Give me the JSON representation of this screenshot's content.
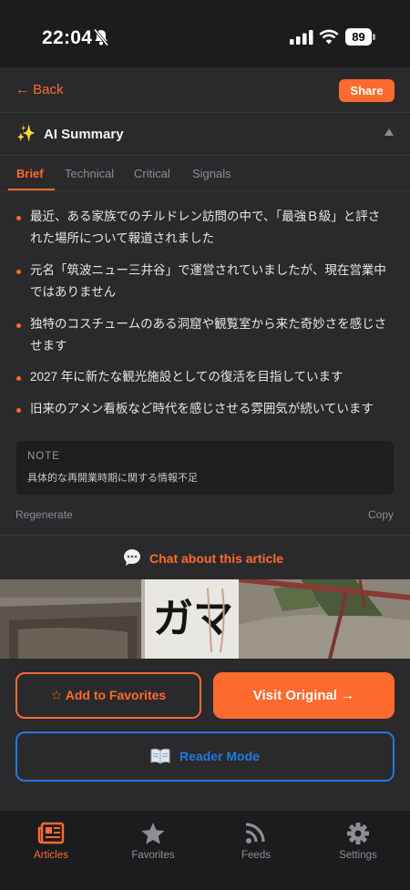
{
  "status_bar": {
    "time": "22:04",
    "battery": "89"
  },
  "nav": {
    "back_label": "← Back",
    "share_label": "Share"
  },
  "summary": {
    "icon": "sparkles-icon",
    "title": "AI Summary",
    "tabs": [
      "Brief",
      "Technical",
      "Critical",
      "Signals"
    ],
    "active_tab": "Brief",
    "bullets": [
      "最近、ある家族でのチルドレン訪問の中で、「最強Ｂ級」と評された場所について報道されました",
      "元名「筑波ニュー三井谷」で運営されていましたが、現在営業中ではありません",
      "独特のコスチュームのある洞窟や観覧室から来た奇妙さを感じさせます",
      "2027 年に新たな観光施設としての復活を目指しています",
      "旧来のアメン看板など時代を感じさせる雰囲気が続いています"
    ],
    "note_label": "NOTE",
    "note_text": "具体的な再開業時期に関する情報不足",
    "regenerate_label": "Regenerate",
    "copy_label": "Copy"
  },
  "chat": {
    "label": "Chat about this article"
  },
  "photo": {
    "sign_text": "ガマ"
  },
  "actions": {
    "favorites_label": "☆ Add to Favorites",
    "visit_label": "Visit Original →",
    "reader_label": "Reader Mode"
  },
  "tabbar": {
    "items": [
      {
        "label": "Articles",
        "icon": "newspaper-icon"
      },
      {
        "label": "Favorites",
        "icon": "star-icon"
      },
      {
        "label": "Feeds",
        "icon": "rss-icon"
      },
      {
        "label": "Settings",
        "icon": "gear-icon"
      }
    ],
    "active": "Articles"
  },
  "colors": {
    "accent": "#ff6a2e",
    "link_blue": "#1f7ae0",
    "background": "#2a2a2c"
  }
}
